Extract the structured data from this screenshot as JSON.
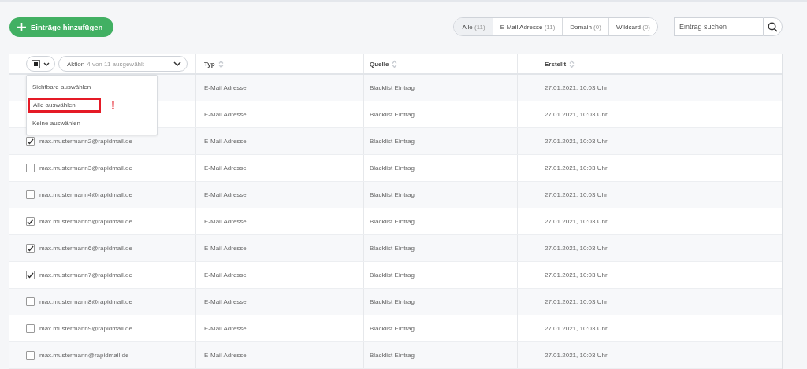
{
  "add_button": {
    "label": "Einträge hinzufügen"
  },
  "filters": [
    {
      "label": "Alle",
      "count": "(11)",
      "selected": true
    },
    {
      "label": "E-Mail Adresse",
      "count": "(11)",
      "selected": false
    },
    {
      "label": "Domain",
      "count": "(0)",
      "selected": false
    },
    {
      "label": "Wildcard",
      "count": "(0)",
      "selected": false
    }
  ],
  "search": {
    "placeholder": "Eintrag suchen"
  },
  "table": {
    "select_all": {
      "indeterminate": true
    },
    "action": {
      "label": "Aktion",
      "count": "4 von 11 ausgewählt"
    },
    "columns": [
      "Typ",
      "Quelle",
      "Erstellt"
    ],
    "rows": [
      {
        "typ": "E-Mail Adresse",
        "quelle": "Blacklist Eintrag",
        "erstellt": "27.01.2021, 10:03 Uhr"
      },
      {
        "typ": "E-Mail Adresse",
        "quelle": "Blacklist Eintrag",
        "erstellt": "27.01.2021, 10:03 Uhr"
      },
      {
        "checked": true,
        "email": "max.mustermann2@rapidmail.de",
        "typ": "E-Mail Adresse",
        "quelle": "Blacklist Eintrag",
        "erstellt": "27.01.2021, 10:03 Uhr"
      },
      {
        "checked": false,
        "email": "max.mustermann3@rapidmail.de",
        "typ": "E-Mail Adresse",
        "quelle": "Blacklist Eintrag",
        "erstellt": "27.01.2021, 10:03 Uhr"
      },
      {
        "checked": false,
        "email": "max.mustermann4@rapidmail.de",
        "typ": "E-Mail Adresse",
        "quelle": "Blacklist Eintrag",
        "erstellt": "27.01.2021, 10:03 Uhr"
      },
      {
        "checked": true,
        "email": "max.mustermann5@rapidmail.de",
        "typ": "E-Mail Adresse",
        "quelle": "Blacklist Eintrag",
        "erstellt": "27.01.2021, 10:03 Uhr"
      },
      {
        "checked": true,
        "email": "max.mustermann6@rapidmail.de",
        "typ": "E-Mail Adresse",
        "quelle": "Blacklist Eintrag",
        "erstellt": "27.01.2021, 10:03 Uhr"
      },
      {
        "checked": true,
        "email": "max.mustermann7@rapidmail.de",
        "typ": "E-Mail Adresse",
        "quelle": "Blacklist Eintrag",
        "erstellt": "27.01.2021, 10:03 Uhr"
      },
      {
        "checked": false,
        "email": "max.mustermann8@rapidmail.de",
        "typ": "E-Mail Adresse",
        "quelle": "Blacklist Eintrag",
        "erstellt": "27.01.2021, 10:03 Uhr"
      },
      {
        "checked": false,
        "email": "max.mustermann9@rapidmail.de",
        "typ": "E-Mail Adresse",
        "quelle": "Blacklist Eintrag",
        "erstellt": "27.01.2021, 10:03 Uhr"
      },
      {
        "checked": false,
        "email": "max.mustermann@rapidmail.de",
        "typ": "E-Mail Adresse",
        "quelle": "Blacklist Eintrag",
        "erstellt": "27.01.2021, 10:03 Uhr"
      }
    ]
  },
  "select_menu": {
    "items": [
      {
        "label": "Sichtbare auswählen",
        "highlighted": false
      },
      {
        "label": "Alle auswählen",
        "highlighted": true
      },
      {
        "label": "Keine auswählen",
        "highlighted": false
      }
    ],
    "annotation": "!"
  }
}
